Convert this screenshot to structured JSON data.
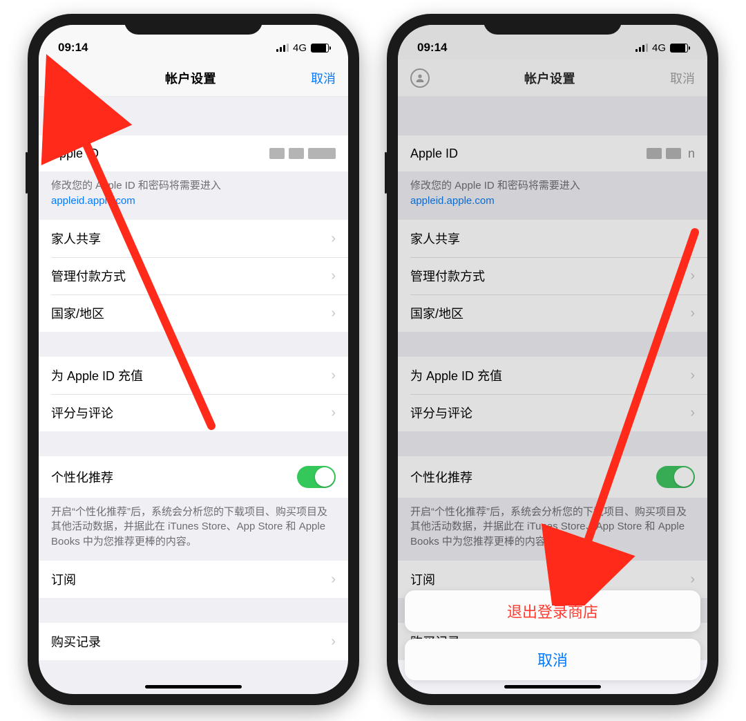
{
  "status": {
    "time": "09:14",
    "network": "4G"
  },
  "nav": {
    "title": "帐户设置",
    "cancel": "取消"
  },
  "account": {
    "row_label": "Apple ID",
    "redacted_trail_right": "n",
    "change_hint": "修改您的 Apple ID 和密码将需要进入",
    "link_text": "appleid.apple.com"
  },
  "groups": {
    "g1": [
      {
        "label": "家人共享"
      },
      {
        "label": "管理付款方式"
      },
      {
        "label": "国家/地区"
      }
    ],
    "g2": [
      {
        "label": "为 Apple ID 充值"
      },
      {
        "label": "评分与评论"
      }
    ],
    "g3": {
      "toggle_label": "个性化推荐",
      "toggle_hint": "开启“个性化推荐”后，系统会分析您的下载项目、购买项目及其他活动数据，并据此在 iTunes Store、App Store 和 Apple Books 中为您推荐更棒的内容。"
    },
    "g4": [
      {
        "label": "订阅"
      },
      {
        "label": "购买记录"
      }
    ]
  },
  "action_sheet": {
    "sign_out": "退出登录商店",
    "cancel": "取消"
  },
  "arrow_color": "#ff2a1a"
}
